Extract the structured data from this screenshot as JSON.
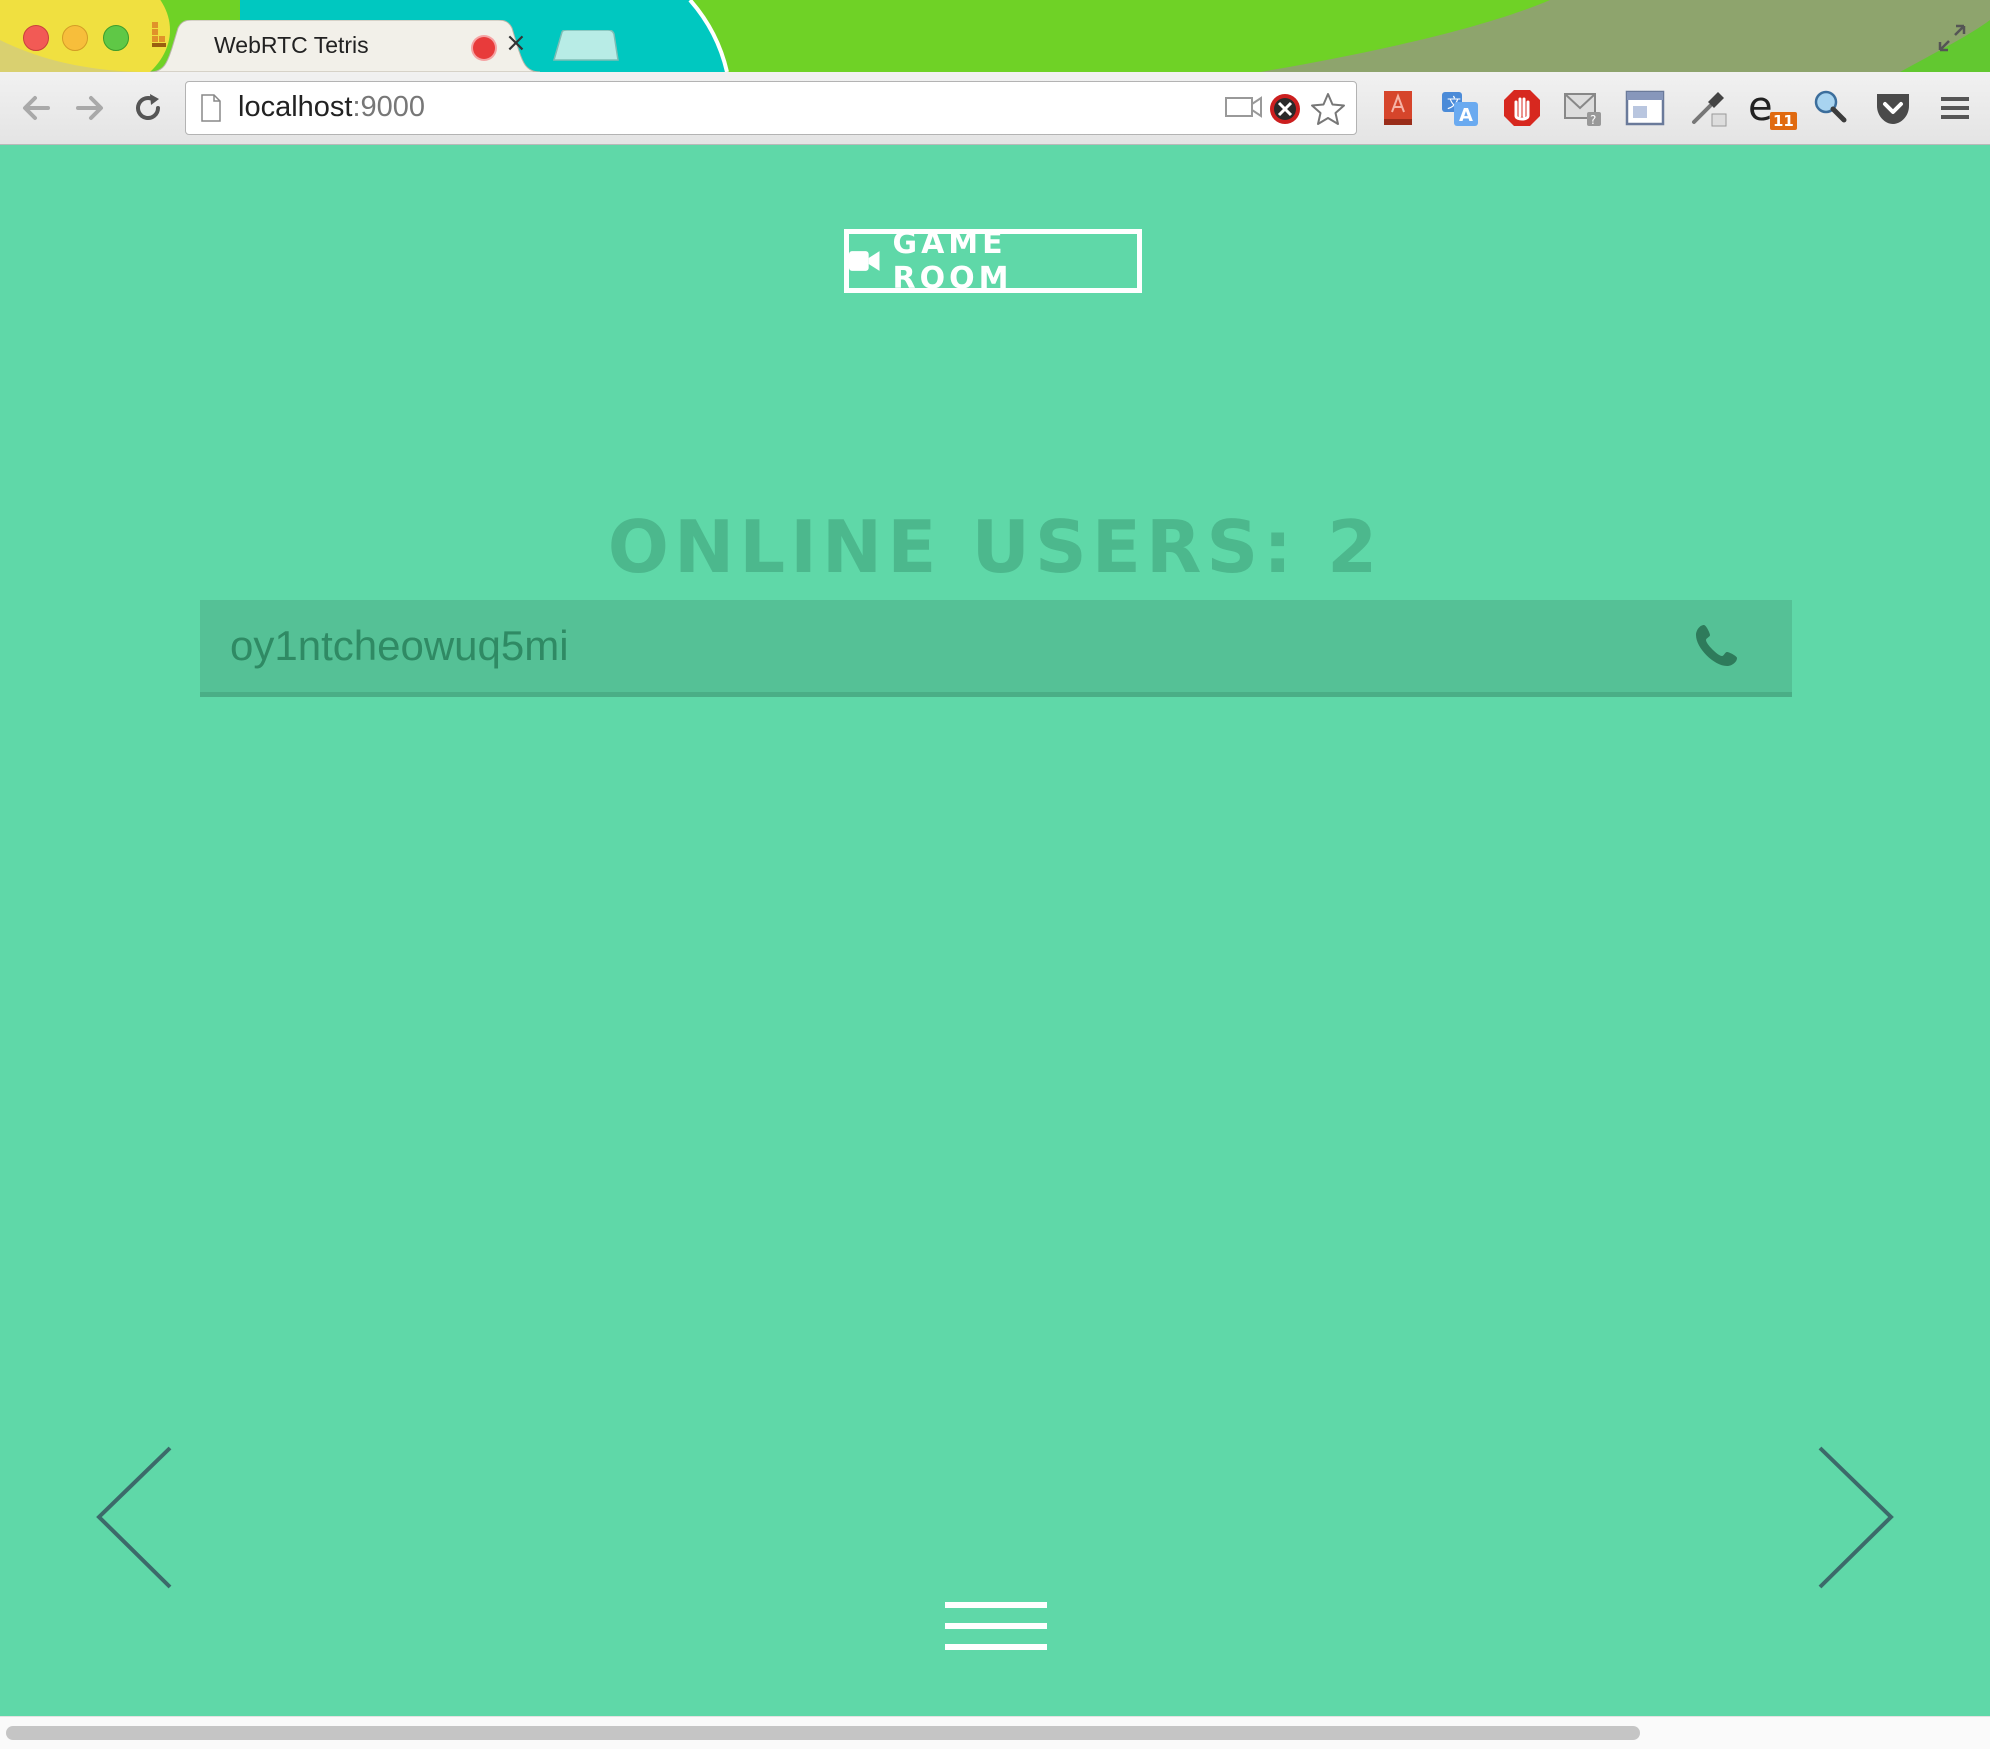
{
  "browser": {
    "tab_title": "WebRTC Tetris",
    "url_host": "localhost",
    "url_port": ":9000",
    "extension_badge": "11"
  },
  "page": {
    "game_room_label": "GAME ROOM",
    "online_users_heading": "ONLINE USERS: 2",
    "users": [
      {
        "name": "oy1ntcheowuq5mi"
      }
    ]
  },
  "colors": {
    "background": "#5fd8a8",
    "heading": "#4cb88d",
    "row": "#55c196",
    "row_text": "#2f8a64",
    "nav_arrows": "#3c6a6a"
  }
}
